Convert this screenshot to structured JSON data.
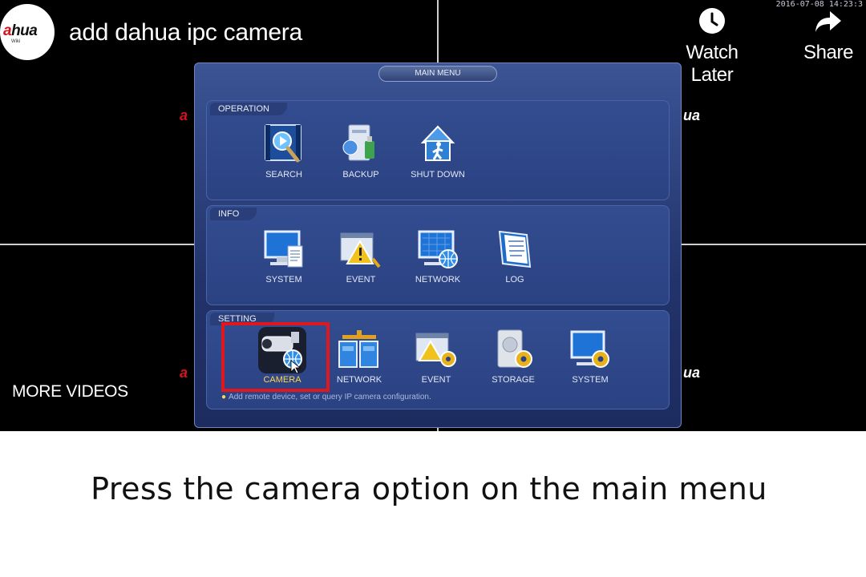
{
  "video": {
    "timestamp": "2016-07-08 14:23:3",
    "channel_logo": {
      "brand_a": "a",
      "brand_rest": "hua",
      "brand_prefix": "a",
      "sub": "Wiki"
    },
    "title": "add dahua ipc camera",
    "actions": [
      {
        "label": "Watch Later",
        "icon": "clock-icon"
      },
      {
        "label": "Share",
        "icon": "share-arrow-icon"
      }
    ],
    "more_videos": "MORE VIDEOS",
    "ghost_logos": {
      "left": "a",
      "right": "ua"
    }
  },
  "main_menu": {
    "title": "MAIN MENU",
    "sections": [
      {
        "name": "OPERATION",
        "items": [
          {
            "label": "SEARCH",
            "icon": "film-search-icon"
          },
          {
            "label": "BACKUP",
            "icon": "usb-backup-icon"
          },
          {
            "label": "SHUT DOWN",
            "icon": "exit-house-icon"
          }
        ]
      },
      {
        "name": "INFO",
        "items": [
          {
            "label": "SYSTEM",
            "icon": "monitor-doc-icon"
          },
          {
            "label": "EVENT",
            "icon": "warning-window-icon"
          },
          {
            "label": "NETWORK",
            "icon": "monitor-globe-icon"
          },
          {
            "label": "LOG",
            "icon": "log-book-icon"
          }
        ]
      },
      {
        "name": "SETTING",
        "items": [
          {
            "label": "CAMERA",
            "icon": "camera-globe-icon",
            "selected": true
          },
          {
            "label": "NETWORK",
            "icon": "network-blocks-icon"
          },
          {
            "label": "EVENT",
            "icon": "event-gear-icon"
          },
          {
            "label": "STORAGE",
            "icon": "hdd-gear-icon"
          },
          {
            "label": "SYSTEM",
            "icon": "monitor-gear-icon"
          }
        ]
      }
    ],
    "hint": "Add remote device, set or query IP camera configuration."
  },
  "caption": "Press the camera option on the main menu",
  "colors": {
    "highlight": "#e0171d",
    "selected_label": "#ffd84a",
    "menu_bg": "#22336b"
  }
}
